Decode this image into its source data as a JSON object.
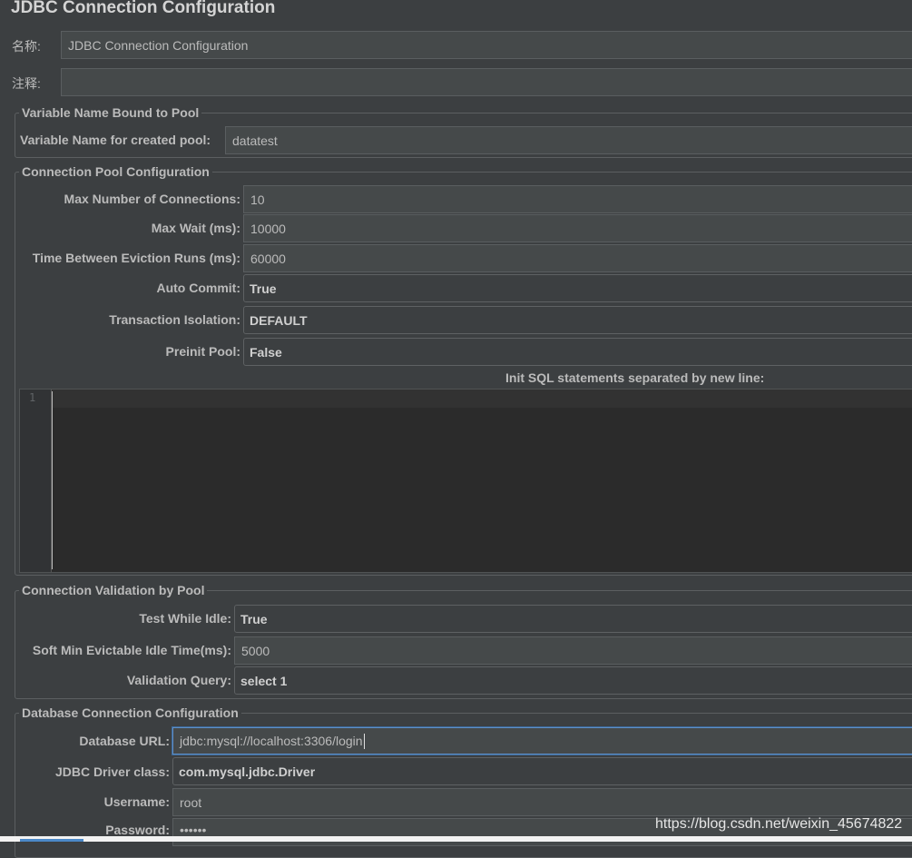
{
  "title": "JDBC Connection Configuration",
  "name_row": {
    "label": "名称:",
    "value": "JDBC Connection Configuration"
  },
  "comment_row": {
    "label": "注释:",
    "value": ""
  },
  "variable_group": {
    "legend": "Variable Name Bound to Pool",
    "var_label": "Variable Name for created pool:",
    "var_value": "datatest"
  },
  "pool_group": {
    "legend": "Connection Pool Configuration",
    "max_conn_label": "Max Number of Connections:",
    "max_conn_value": "10",
    "max_wait_label": "Max Wait (ms):",
    "max_wait_value": "10000",
    "eviction_label": "Time Between Eviction Runs (ms):",
    "eviction_value": "60000",
    "auto_commit_label": "Auto Commit:",
    "auto_commit_value": "True",
    "isolation_label": "Transaction Isolation:",
    "isolation_value": "DEFAULT",
    "preinit_label": "Preinit Pool:",
    "preinit_value": "False",
    "init_sql_label": "Init SQL statements separated by new line:",
    "line_number": "1"
  },
  "validation_group": {
    "legend": "Connection Validation by Pool",
    "test_idle_label": "Test While Idle:",
    "test_idle_value": "True",
    "soft_min_label": "Soft Min Evictable Idle Time(ms):",
    "soft_min_value": "5000",
    "validation_query_label": "Validation Query:",
    "validation_query_value": "select 1"
  },
  "db_group": {
    "legend": "Database Connection Configuration",
    "url_label": "Database URL:",
    "url_value": "jdbc:mysql://localhost:3306/login",
    "driver_label": "JDBC Driver class:",
    "driver_value": "com.mysql.jdbc.Driver",
    "username_label": "Username:",
    "username_value": "root",
    "password_label": "Password:",
    "password_value": "••••••"
  },
  "watermark": "https://blog.csdn.net/weixin_45674822"
}
